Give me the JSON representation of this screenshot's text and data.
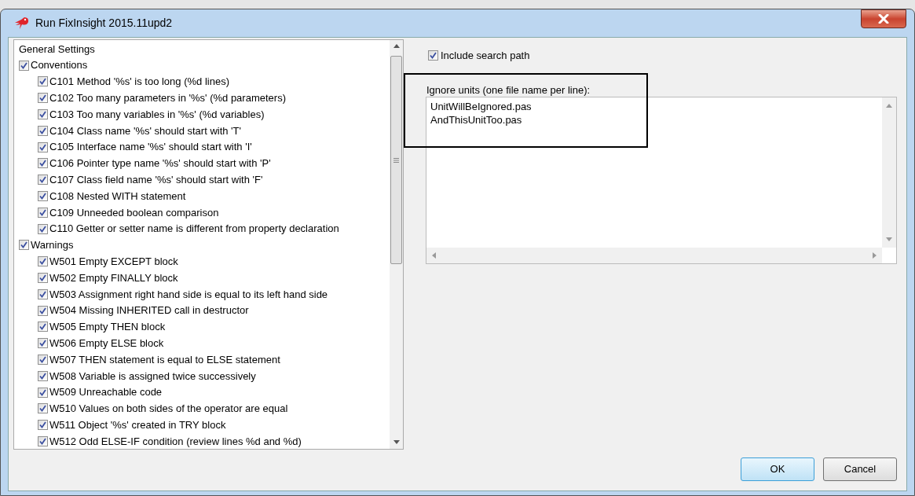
{
  "window": {
    "title": "Run FixInsight 2015.11upd2"
  },
  "tree": {
    "items": [
      {
        "label": "General Settings"
      },
      {
        "label": "Conventions",
        "checked": true,
        "children": [
          {
            "label": "C101 Method '%s' is too long (%d lines)",
            "checked": true
          },
          {
            "label": "C102 Too many parameters in '%s' (%d parameters)",
            "checked": true
          },
          {
            "label": "C103 Too many variables in '%s' (%d variables)",
            "checked": true
          },
          {
            "label": "C104 Class name '%s' should start with 'T'",
            "checked": true
          },
          {
            "label": "C105 Interface name '%s' should start with 'I'",
            "checked": true
          },
          {
            "label": "C106 Pointer type name '%s' should start with 'P'",
            "checked": true
          },
          {
            "label": "C107 Class field name '%s' should start with 'F'",
            "checked": true
          },
          {
            "label": "C108 Nested WITH statement",
            "checked": true
          },
          {
            "label": "C109 Unneeded boolean comparison",
            "checked": true
          },
          {
            "label": "C110 Getter or setter name is different from property declaration",
            "checked": true
          }
        ]
      },
      {
        "label": "Warnings",
        "checked": true,
        "children": [
          {
            "label": "W501 Empty EXCEPT block",
            "checked": true
          },
          {
            "label": "W502 Empty FINALLY block",
            "checked": true
          },
          {
            "label": "W503 Assignment right hand side is equal to its left hand side",
            "checked": true
          },
          {
            "label": "W504 Missing INHERITED call in destructor",
            "checked": true
          },
          {
            "label": "W505 Empty THEN block",
            "checked": true
          },
          {
            "label": "W506 Empty ELSE block",
            "checked": true
          },
          {
            "label": "W507 THEN statement is equal to ELSE statement",
            "checked": true
          },
          {
            "label": "W508 Variable is assigned twice successively",
            "checked": true
          },
          {
            "label": "W509 Unreachable code",
            "checked": true
          },
          {
            "label": "W510 Values on both sides of the operator are equal",
            "checked": true
          },
          {
            "label": "W511 Object '%s' created in TRY block",
            "checked": true
          },
          {
            "label": "W512 Odd ELSE-IF condition (review lines %d and %d)",
            "checked": true
          }
        ]
      }
    ]
  },
  "include_search_path": {
    "label": "Include search path",
    "checked": true
  },
  "ignore_units": {
    "label": "Ignore units (one file name per line):",
    "lines": [
      "UnitWillBeIgnored.pas",
      "AndThisUnitToo.pas"
    ]
  },
  "buttons": [
    {
      "label": "OK",
      "default": true
    },
    {
      "label": "Cancel",
      "default": false
    }
  ]
}
